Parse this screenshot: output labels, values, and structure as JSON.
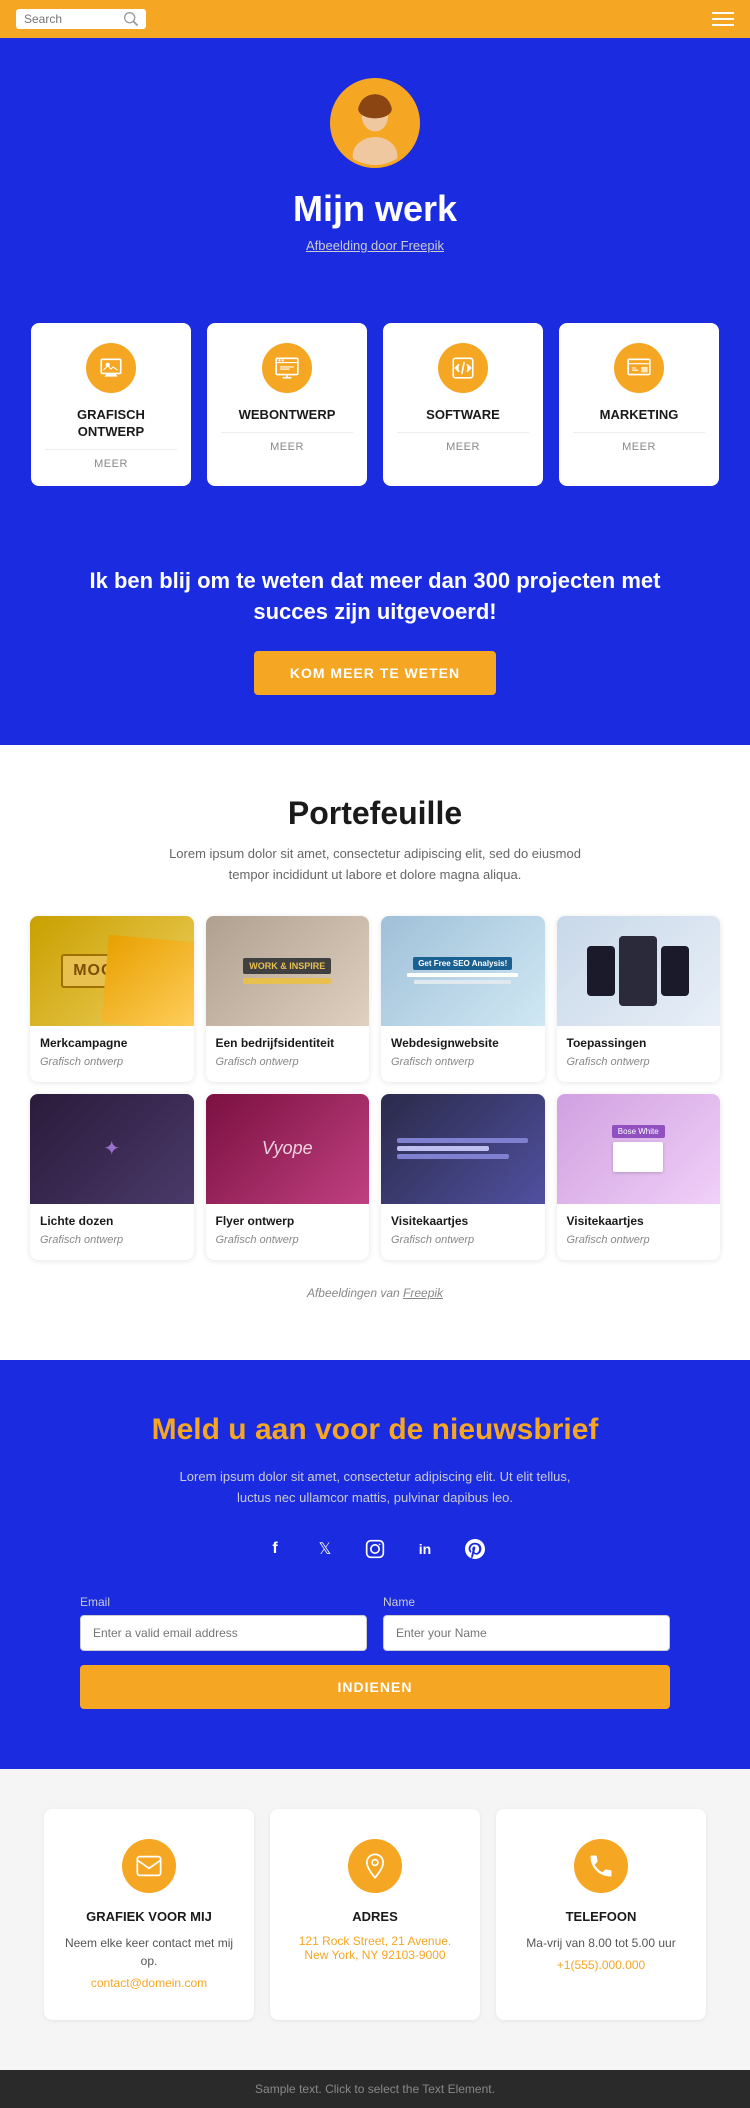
{
  "header": {
    "search_placeholder": "Search",
    "menu_label": "Menu"
  },
  "hero": {
    "title": "Mijn werk",
    "subtitle": "Afbeelding door Freepik"
  },
  "services": [
    {
      "id": "grafisch",
      "title": "GRAFISCH\nONTWERP",
      "meer": "MEER"
    },
    {
      "id": "webontwerp",
      "title": "WEBONTWERP",
      "meer": "MEER"
    },
    {
      "id": "software",
      "title": "SOFTWARE",
      "meer": "MEER"
    },
    {
      "id": "marketing",
      "title": "MARKETING",
      "meer": "MEER"
    }
  ],
  "cta": {
    "text": "Ik ben blij om te weten dat meer dan 300 projecten met succes zijn uitgevoerd!",
    "button": "KOM MEER TE WETEN"
  },
  "portfolio": {
    "title": "Portefeuille",
    "description": "Lorem ipsum dolor sit amet, consectetur adipiscing elit, sed do eiusmod tempor incididunt ut labore et dolore magna aliqua.",
    "credit": "Afbeeldingen van Freepik",
    "items": [
      {
        "title": "Merkcampagne",
        "category": "Grafisch ontwerp",
        "color": "#e8c870"
      },
      {
        "title": "Een bedrijfsidentiteit",
        "category": "Grafisch ontwerp",
        "color": "#c8b090"
      },
      {
        "title": "Webdesignwebsite",
        "category": "Grafisch ontwerp",
        "color": "#b0d0e0"
      },
      {
        "title": "Toepassingen",
        "category": "Grafisch ontwerp",
        "color": "#d0dded"
      },
      {
        "title": "Lichte dozen",
        "category": "Grafisch ontwerp",
        "color": "#3a2a4a"
      },
      {
        "title": "Flyer ontwerp",
        "category": "Grafisch ontwerp",
        "color": "#9a2050"
      },
      {
        "title": "Visitekaartjes",
        "category": "Grafisch ontwerp",
        "color": "#3a3a5a"
      },
      {
        "title": "Visitekaartjes",
        "category": "Grafisch ontwerp",
        "color": "#e8d0e8"
      }
    ]
  },
  "newsletter": {
    "title": "Meld u aan voor de nieuwsbrief",
    "description": "Lorem ipsum dolor sit amet, consectetur adipiscing elit. Ut elit tellus, luctus nec ullamcor mattis, pulvinar dapibus leo.",
    "social": [
      "f",
      "t",
      "i",
      "in",
      "p"
    ],
    "email_label": "Email",
    "email_placeholder": "Enter a valid email address",
    "name_label": "Name",
    "name_placeholder": "Enter your Name",
    "submit_label": "INDIENEN"
  },
  "contact": {
    "cards": [
      {
        "id": "grafiek",
        "title": "GRAFIEK VOOR MIJ",
        "text": "Neem elke keer contact met mij op.",
        "link": "contact@domein.com",
        "link_type": "email"
      },
      {
        "id": "adres",
        "title": "ADRES",
        "text": "",
        "link": "121 Rock Street, 21 Avenue. New York, NY 92103-9000",
        "link_type": "address"
      },
      {
        "id": "telefoon",
        "title": "TELEFOON",
        "text": "Ma-vrij van 8.00 tot 5.00 uur",
        "link": "+1(555).000.000",
        "link_type": "phone"
      }
    ]
  },
  "footer": {
    "text": "Sample text. Click to select the Text Element."
  }
}
